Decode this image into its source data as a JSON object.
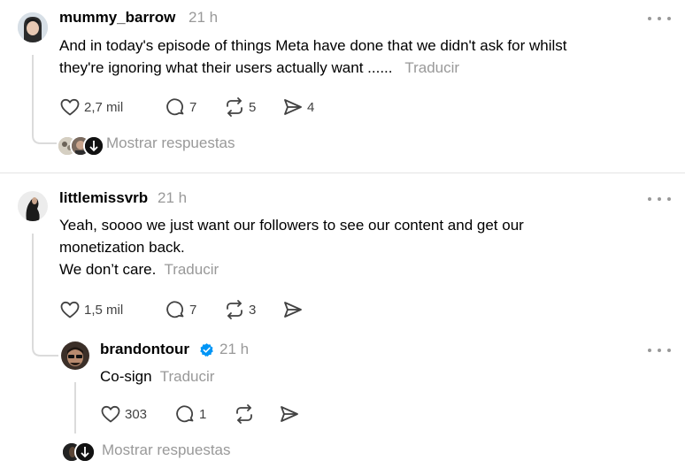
{
  "posts": [
    {
      "username": "mummy_barrow",
      "time": "21 h",
      "text_lines": [
        "And in today's episode of things Meta have done that we didn't ask for whilst",
        "they're ignoring what their users actually want ......"
      ],
      "translate_label": "Traducir",
      "likes": "2,7 mil",
      "replies": "7",
      "reposts": "5",
      "shares": "4",
      "show_replies_label": "Mostrar respuestas"
    },
    {
      "username": "littlemissvrb",
      "time": "21 h",
      "text_lines": [
        "Yeah, soooo we just want our followers to see our content and get our",
        "monetization back.",
        "We don’t care."
      ],
      "translate_label": "Traducir",
      "likes": "1,5 mil",
      "replies": "7",
      "reposts": "3"
    }
  ],
  "reply": {
    "username": "brandontour",
    "time": "21 h",
    "text": "Co-sign",
    "translate_label": "Traducir",
    "likes": "303",
    "replies": "1",
    "show_replies_label": "Mostrar respuestas"
  },
  "colors": {
    "verified": "#0095f6",
    "muted": "#999999",
    "icon": "#424242"
  },
  "icons": [
    "heart-icon",
    "comment-icon",
    "repost-icon",
    "share-icon",
    "verified-badge-icon",
    "more-options-icon"
  ]
}
